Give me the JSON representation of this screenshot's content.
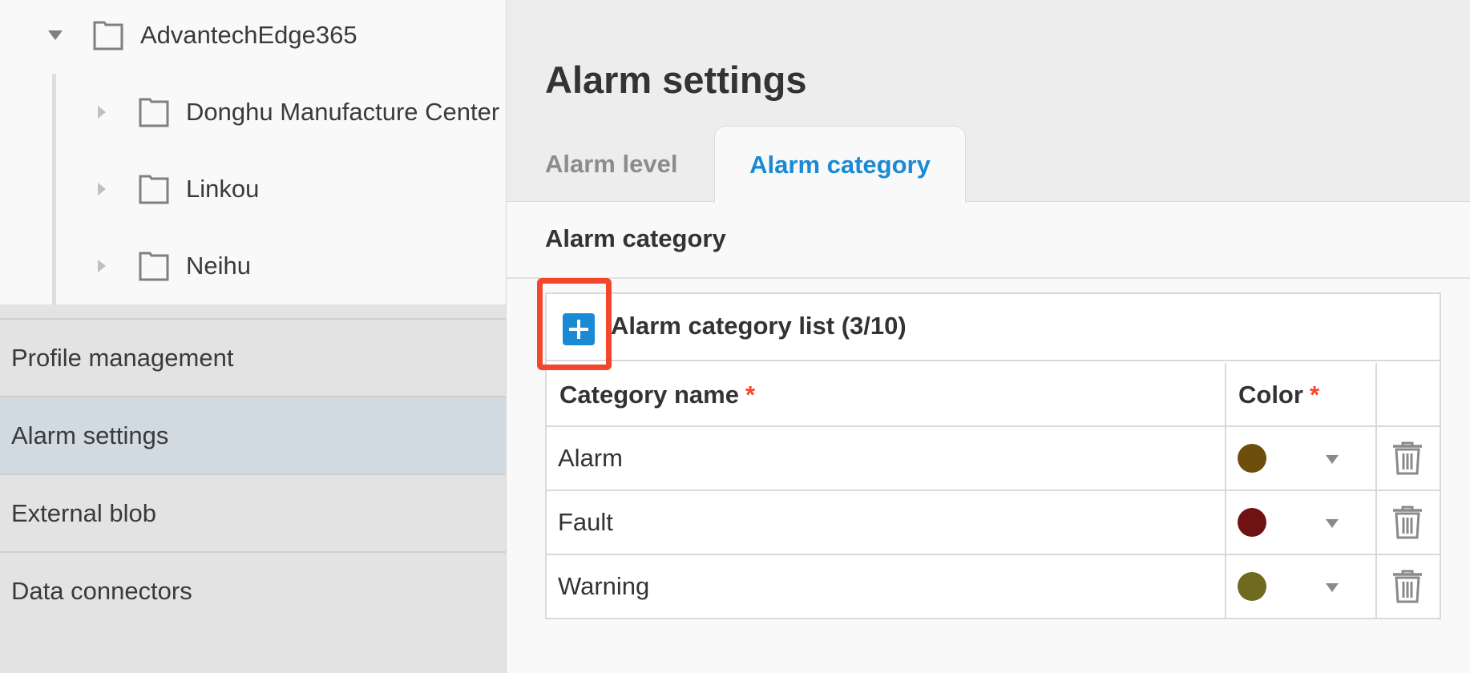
{
  "tree": {
    "root": {
      "label": "AdvantechEdge365",
      "icon": "folder-icon"
    },
    "children": [
      {
        "label": "Donghu Manufacture Center",
        "icon": "folder-icon"
      },
      {
        "label": "Linkou",
        "icon": "folder-icon"
      },
      {
        "label": "Neihu",
        "icon": "folder-icon"
      }
    ]
  },
  "sidebar": {
    "items": [
      {
        "label": "Profile management",
        "active": false
      },
      {
        "label": "Alarm settings",
        "active": true
      },
      {
        "label": "External blob",
        "active": false
      },
      {
        "label": "Data connectors",
        "active": false
      }
    ]
  },
  "main": {
    "title": "Alarm settings",
    "tabs": [
      {
        "label": "Alarm level",
        "active": false
      },
      {
        "label": "Alarm category",
        "active": true
      }
    ],
    "section_title": "Alarm category",
    "list": {
      "title": "Alarm category list (3/10)",
      "add_icon": "plus-icon",
      "columns": {
        "name": "Category name",
        "color": "Color",
        "required_mark": "*"
      },
      "rows": [
        {
          "name": "Alarm",
          "color": "#6e4e0a"
        },
        {
          "name": "Fault",
          "color": "#6e1214"
        },
        {
          "name": "Warning",
          "color": "#6e6a1e"
        }
      ],
      "delete_icon": "trash-icon"
    }
  },
  "colors": {
    "accent": "#1a8ad4",
    "highlight": "#f2472a",
    "active_nav": "#d1d9e1"
  }
}
